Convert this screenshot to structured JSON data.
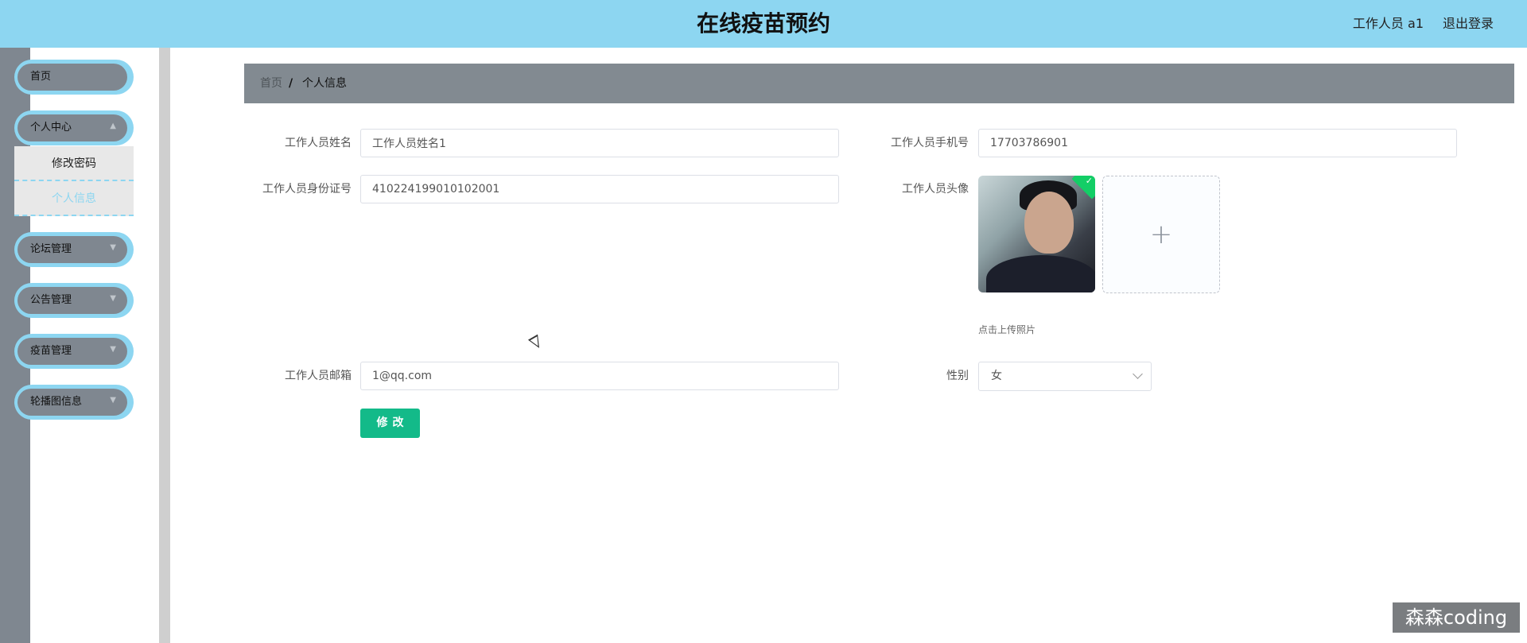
{
  "header": {
    "title": "在线疫苗预约",
    "user_label": "工作人员 a1",
    "logout_label": "退出登录"
  },
  "sidebar": {
    "items": [
      {
        "label": "首页"
      },
      {
        "label": "个人中心"
      },
      {
        "label": "论坛管理"
      },
      {
        "label": "公告管理"
      },
      {
        "label": "疫苗管理"
      },
      {
        "label": "轮播图信息"
      }
    ],
    "submenu": [
      "修改密码",
      "个人信息"
    ]
  },
  "breadcrumb": {
    "home": "首页",
    "separator": "/",
    "current": "个人信息"
  },
  "form": {
    "name_label": "工作人员姓名",
    "name_value": "工作人员姓名1",
    "phone_label": "工作人员手机号",
    "phone_value": "17703786901",
    "id_label": "工作人员身份证号",
    "id_value": "410224199010102001",
    "avatar_label": "工作人员头像",
    "upload_hint": "点击上传照片",
    "email_label": "工作人员邮箱",
    "email_value": "1@qq.com",
    "gender_label": "性别",
    "gender_value": "女",
    "submit_label": "修改"
  },
  "watermark": "森森coding",
  "colors": {
    "header_bg": "#8dd6f1",
    "menu_inner": "#7f8790",
    "breadcrumb_bg": "#828a91",
    "submit_bg": "#13ba89"
  }
}
